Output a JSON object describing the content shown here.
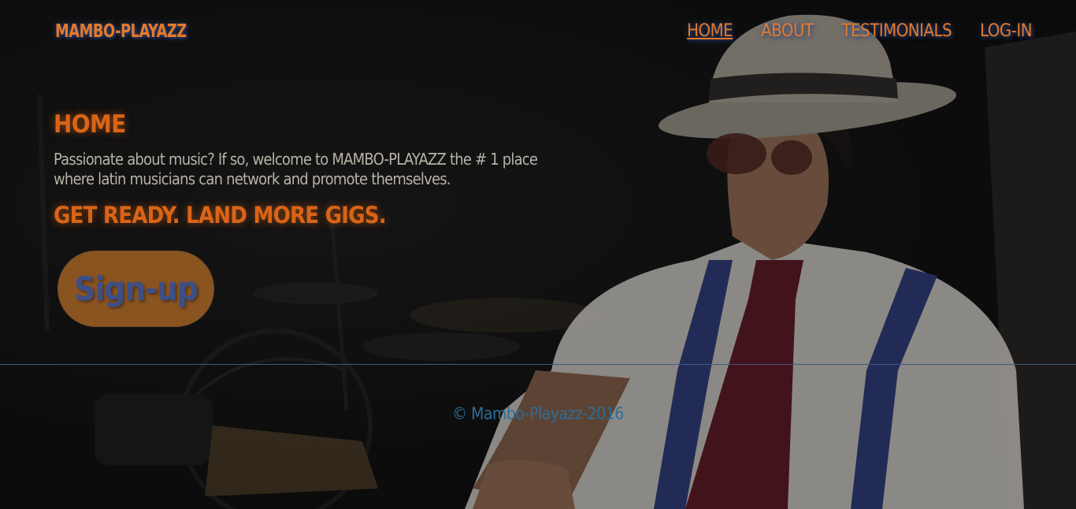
{
  "header": {
    "brand": "MAMBO-PLAYAZZ",
    "nav": [
      {
        "label": "HOME",
        "active": true
      },
      {
        "label": "ABOUT",
        "active": false
      },
      {
        "label": "TESTIMONIALS",
        "active": false
      },
      {
        "label": "LOG-IN",
        "active": false
      }
    ]
  },
  "main": {
    "title": "HOME",
    "intro": "Passionate about music? If so, welcome to MAMBO-PLAYAZZ the # 1 place where latin musicians can network and promote themselves.",
    "tagline": "GET READY. LAND MORE GIGS.",
    "signup_label": "Sign-up"
  },
  "footer": {
    "text": "© Mambo-Playazz-2016"
  },
  "colors": {
    "accent_orange": "#d96417",
    "nav_orange": "#e37a2a",
    "button_bg": "#8a5420",
    "button_text": "#3d4f86",
    "footer_blue": "#2d6d9a",
    "divider_blue": "#3f5a86",
    "body_text": "#b8b2a8"
  }
}
